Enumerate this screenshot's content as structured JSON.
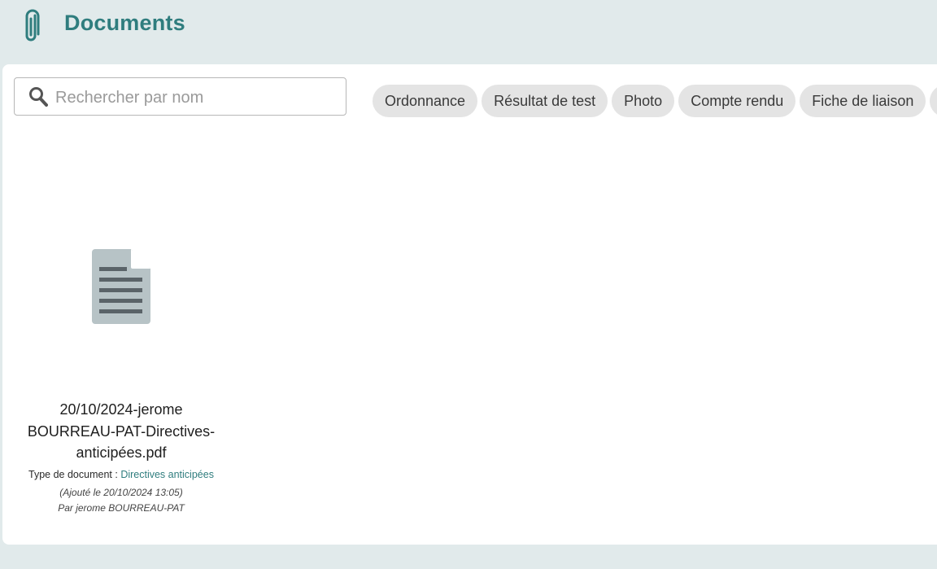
{
  "header": {
    "title": "Documents",
    "icon": "paperclip-icon",
    "accent_color": "#2f7d7e"
  },
  "search": {
    "placeholder": "Rechercher par nom",
    "value": ""
  },
  "filters": [
    {
      "label": "Ordonnance"
    },
    {
      "label": "Résultat de test"
    },
    {
      "label": "Photo"
    },
    {
      "label": "Compte rendu"
    },
    {
      "label": "Fiche de liaison"
    },
    {
      "label": ""
    }
  ],
  "documents": [
    {
      "name": "20/10/2024-jerome BOURREAU-PAT-Directives-anticipées.pdf",
      "type_label": "Type de document :",
      "type_value": "Directives anticipées",
      "added": "(Ajouté le 20/10/2024 13:05)",
      "author": "Par jerome BOURREAU-PAT",
      "icon": "file-text-icon"
    }
  ]
}
